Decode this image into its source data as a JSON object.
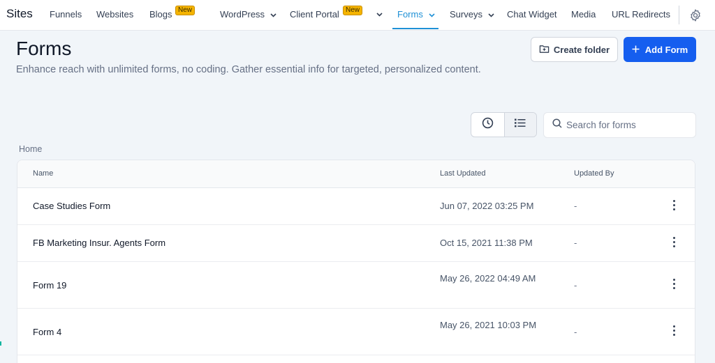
{
  "nav": {
    "title": "Sites",
    "items": [
      {
        "label": "Funnels"
      },
      {
        "label": "Websites"
      },
      {
        "label": "Blogs",
        "badge": "New"
      },
      {
        "label": "WordPress",
        "dropdown": true
      },
      {
        "label": "Client Portal",
        "badge": "New",
        "dropdown": true
      },
      {
        "label": "Forms",
        "dropdown": true,
        "active": true
      },
      {
        "label": "Surveys",
        "dropdown": true
      },
      {
        "label": "Chat Widget"
      },
      {
        "label": "Media"
      },
      {
        "label": "URL Redirects"
      }
    ],
    "settings_icon": "gear-icon"
  },
  "header": {
    "title": "Forms",
    "description": "Enhance reach with unlimited forms, no coding. Gather essential info for targeted, personalized content.",
    "create_folder_label": "Create folder",
    "add_form_label": "Add Form"
  },
  "toolbar": {
    "recent_view_icon": "clock-icon",
    "list_view_icon": "list-icon",
    "search_placeholder": "Search for forms"
  },
  "breadcrumb": "Home",
  "table": {
    "columns": [
      "Name",
      "Last Updated",
      "Updated By"
    ],
    "rows": [
      {
        "name": "Case Studies Form",
        "last_updated": "Jun 07, 2022 03:25 PM",
        "updated_by": "-"
      },
      {
        "name": "FB Marketing Insur. Agents Form",
        "last_updated": "Oct 15, 2021 11:38 PM",
        "updated_by": "-"
      },
      {
        "name": "Form 19",
        "last_updated": "May 26, 2022 04:49 AM",
        "updated_by": "-"
      },
      {
        "name": "Form 4",
        "last_updated": "May 26, 2021 10:03 PM",
        "updated_by": "-"
      }
    ]
  },
  "colors": {
    "accent": "#1e90d6",
    "primary_button": "#155eef",
    "badge": "#f5b400",
    "background": "#f1f5f9"
  }
}
